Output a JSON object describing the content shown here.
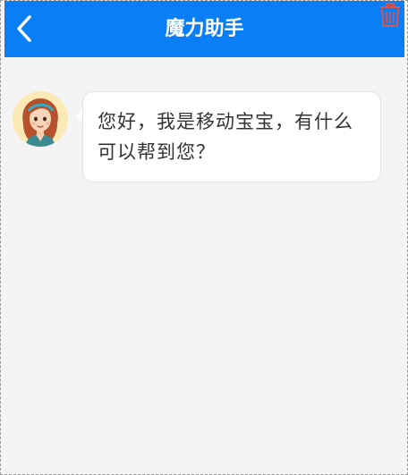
{
  "header": {
    "title": "魔力助手",
    "background_color": "#0a7ef5",
    "back_icon": "chevron-left-icon",
    "delete_icon": "trash-icon",
    "delete_icon_color": "#d9534f"
  },
  "chat": {
    "messages": [
      {
        "sender": "assistant",
        "avatar": "girl-avatar",
        "text": "您好，我是移动宝宝，有什么可以帮到您？"
      }
    ]
  }
}
